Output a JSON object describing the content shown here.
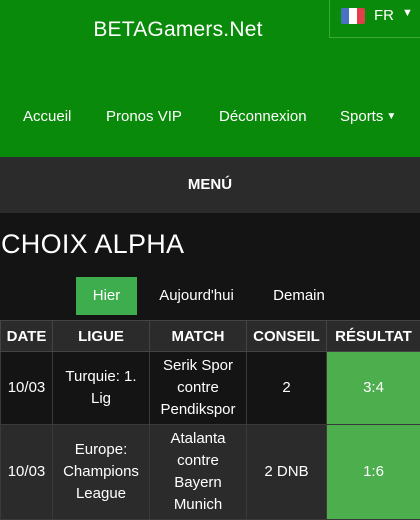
{
  "site": {
    "title": "BETAGamers.Net"
  },
  "language": {
    "code": "FR",
    "flag_colors": [
      "#4a72c2",
      "#ffffff",
      "#e0404a"
    ],
    "caret_icon": "caret-down-icon"
  },
  "nav": {
    "items": [
      {
        "label": "Accueil"
      },
      {
        "label": "Pronos VIP"
      },
      {
        "label": "Déconnexion"
      },
      {
        "label": "Sports",
        "dropdown": true
      }
    ]
  },
  "menu": {
    "label": "MENÚ"
  },
  "page": {
    "heading": "CHOIX ALPHA"
  },
  "tabs": [
    {
      "label": "Hier",
      "active": true
    },
    {
      "label": "Aujourd'hui",
      "active": false
    },
    {
      "label": "Demain",
      "active": false
    }
  ],
  "table": {
    "headers": [
      "DATE",
      "LIGUE",
      "MATCH",
      "CONSEIL",
      "RÉSULTAT"
    ],
    "rows": [
      {
        "date": "10/03",
        "league": "Turquie: 1. Lig",
        "match": "Serik Spor contre Pendikspor",
        "advice": "2",
        "result": "3:4"
      },
      {
        "date": "10/03",
        "league": "Europe: Champions League",
        "match": "Atalanta contre Bayern Munich",
        "advice": "2 DNB",
        "result": "1:6"
      }
    ]
  },
  "colors": {
    "header_green": "#0a8a0a",
    "accent_green": "#3dad4d",
    "result_green": "#4cae4c",
    "dark_bg": "#141414",
    "panel_bg": "#2b2b2b"
  }
}
